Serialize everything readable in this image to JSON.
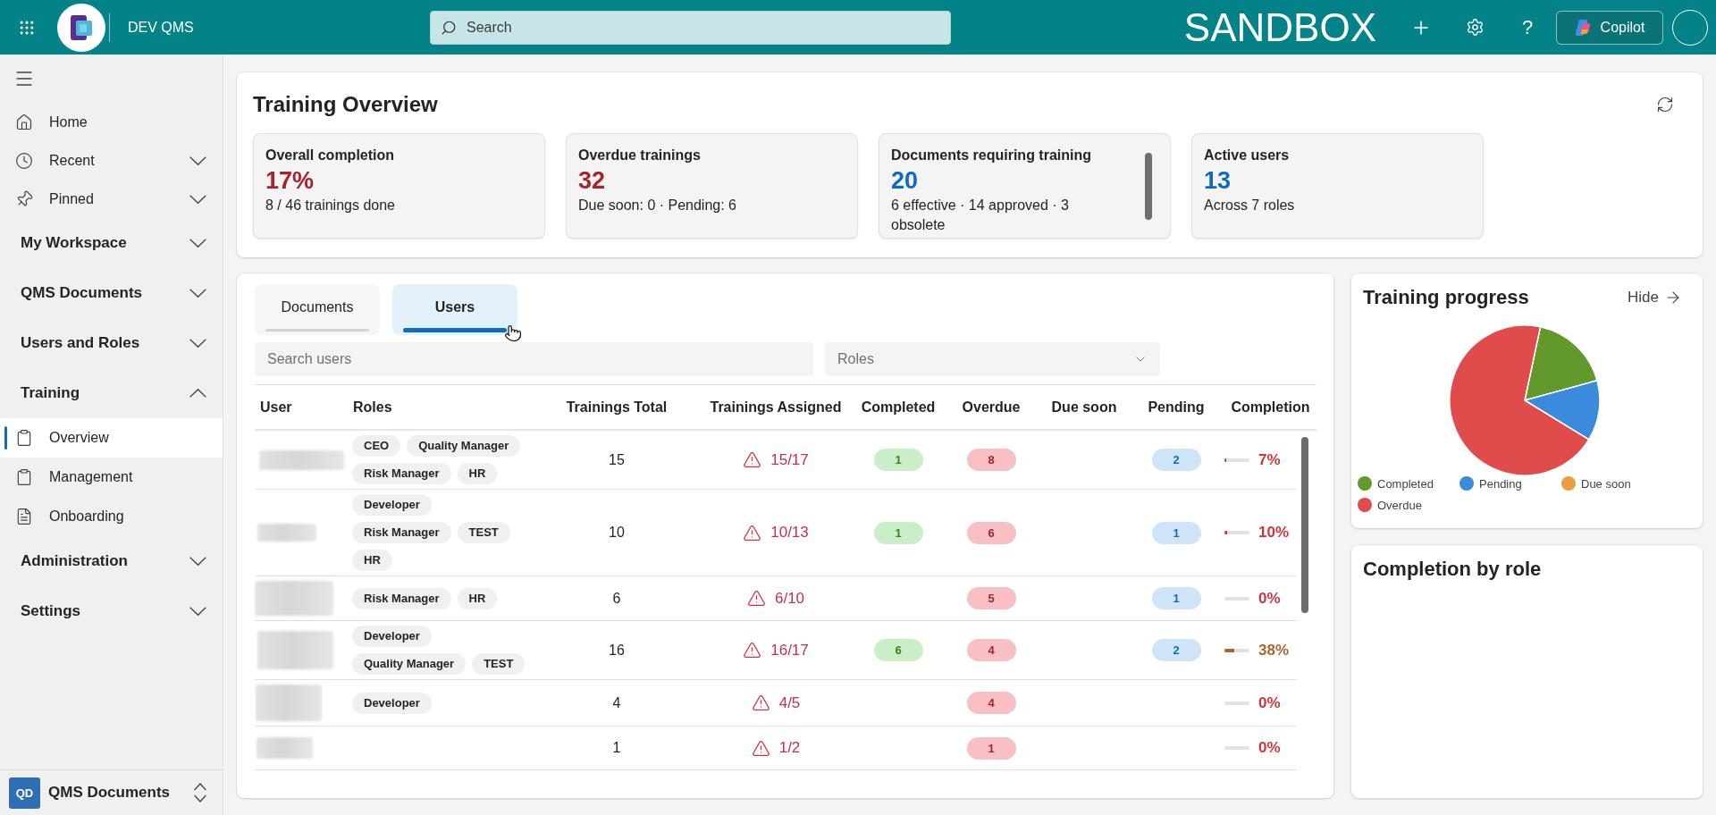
{
  "app_bar": {
    "app_name": "DEV QMS",
    "search": {
      "placeholder": "Search"
    },
    "environment": "SANDBOX",
    "help": "?",
    "copilot": "Copilot"
  },
  "sidebar": {
    "links": [
      {
        "kind": "link",
        "label": "Home"
      },
      {
        "kind": "menu",
        "label": "Recent",
        "expanded": false
      },
      {
        "kind": "menu",
        "label": "Pinned",
        "expanded": false
      }
    ],
    "sections": [
      {
        "label": "My Workspace",
        "expanded": false
      },
      {
        "label": "QMS Documents",
        "expanded": false
      },
      {
        "label": "Users and Roles",
        "expanded": false
      },
      {
        "label": "Training",
        "expanded": true,
        "children": [
          {
            "label": "Overview",
            "selected": true
          },
          {
            "label": "Management",
            "selected": false
          },
          {
            "label": "Onboarding",
            "selected": false
          }
        ]
      },
      {
        "label": "Administration",
        "expanded": false
      },
      {
        "label": "Settings",
        "expanded": false
      }
    ],
    "workspace": {
      "initials": "QD",
      "label": "QMS Documents"
    }
  },
  "overview": {
    "title": "Training Overview",
    "stats": [
      {
        "label": "Overall completion",
        "value": "17%",
        "detail": "8 / 46 trainings done",
        "color": "#a4262c"
      },
      {
        "label": "Overdue trainings",
        "value": "32",
        "detail": "Due soon: 0 · Pending: 6",
        "color": "#a4262c"
      },
      {
        "label": "Documents requiring training",
        "value": "20",
        "detail": "6 effective · 14 approved · 3 obsolete",
        "color": "#0f6cbd"
      },
      {
        "label": "Active users",
        "value": "13",
        "detail": "Across 7 roles",
        "color": "#0f6cbd"
      }
    ]
  },
  "users_panel": {
    "tabs": [
      {
        "label": "Documents",
        "selected": false
      },
      {
        "label": "Users",
        "selected": true
      }
    ],
    "search": {
      "placeholder": "Search users"
    },
    "roles_filter": {
      "placeholder": "Roles"
    },
    "table": {
      "columns": [
        "User",
        "Roles",
        "Trainings Total",
        "Trainings Assigned",
        "Completed",
        "Overdue",
        "Due soon",
        "Pending",
        "Completion"
      ],
      "rows": [
        {
          "roles": [
            "CEO",
            "Quality Manager",
            "Risk Manager",
            "HR"
          ],
          "total": "15",
          "assigned": "15/17",
          "warning": true,
          "completed": "1",
          "overdue": "8",
          "pending": "2",
          "completion": {
            "level": 0.07,
            "label": "7%",
            "color": "#d13438"
          }
        },
        {
          "roles": [
            "Developer",
            "Risk Manager",
            "TEST",
            "HR"
          ],
          "total": "10",
          "assigned": "10/13",
          "warning": true,
          "completed": "1",
          "overdue": "6",
          "pending": "1",
          "completion": {
            "level": 0.1,
            "label": "10%",
            "color": "#d13438"
          }
        },
        {
          "roles": [
            "Risk Manager",
            "HR"
          ],
          "total": "6",
          "assigned": "6/10",
          "warning": true,
          "overdue": "5",
          "pending": "1",
          "completion": {
            "level": 0,
            "label": "0%",
            "color": "#d13438"
          }
        },
        {
          "roles": [
            "Developer",
            "Quality Manager",
            "TEST"
          ],
          "total": "16",
          "assigned": "16/17",
          "warning": true,
          "completed": "6",
          "overdue": "4",
          "pending": "2",
          "completion": {
            "level": 0.38,
            "label": "38%",
            "color": "#a8672e"
          }
        },
        {
          "roles": [
            "Developer"
          ],
          "total": "4",
          "assigned": "4/5",
          "warning": true,
          "overdue": "4",
          "completion": {
            "level": 0,
            "label": "0%",
            "color": "#d13438"
          }
        },
        {
          "total": "1",
          "assigned": "1/2",
          "warning": true,
          "overdue": "1",
          "completion": {
            "level": 0,
            "label": "0%",
            "color": "#d13438"
          }
        }
      ]
    }
  },
  "training_progress": {
    "title": "Training progress",
    "hide": "Hide",
    "chart_data": {
      "type": "pie",
      "categories": [
        "Completed",
        "Pending",
        "Due soon",
        "Overdue"
      ],
      "values": [
        17.4,
        13.0,
        0,
        69.6
      ],
      "colors": [
        "#63992a",
        "#3b8bdc",
        "#e89d41",
        "#e04b4c"
      ],
      "legend": "bottom"
    }
  },
  "completion_by_role": {
    "title": "Completion by role"
  }
}
